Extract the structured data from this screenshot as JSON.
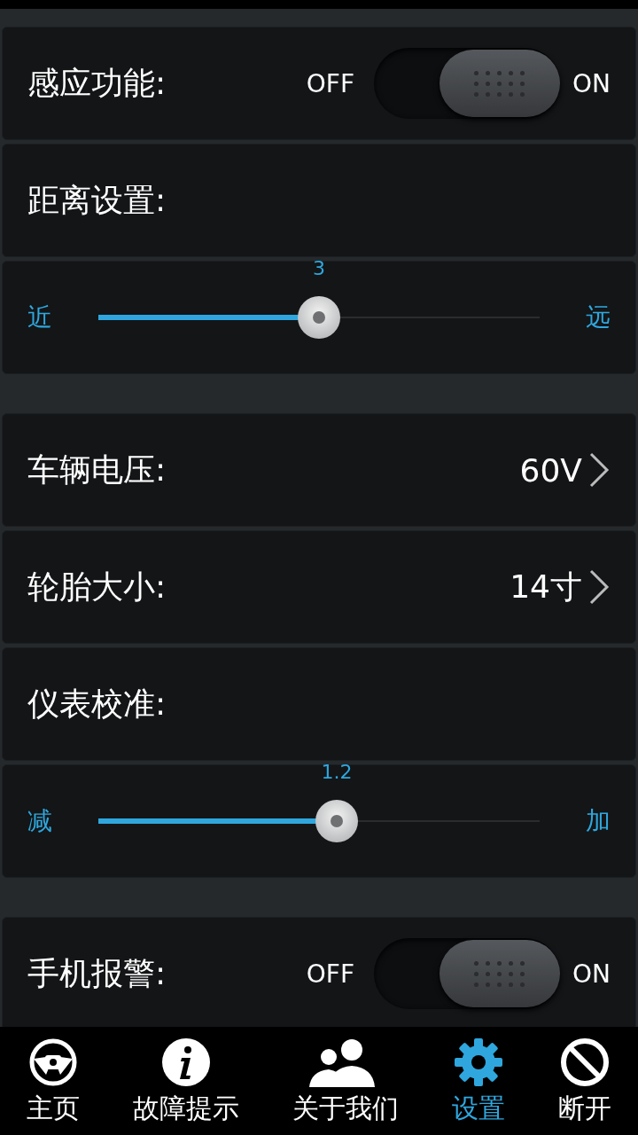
{
  "groups": [
    {
      "rows": [
        {
          "kind": "toggle",
          "label": "感应功能:",
          "off_text": "OFF",
          "on_text": "ON",
          "on": true
        },
        {
          "kind": "label",
          "label": "距离设置:"
        },
        {
          "kind": "slider",
          "min_label": "近",
          "max_label": "远",
          "reading": "3",
          "level": 0.5
        }
      ]
    },
    {
      "rows": [
        {
          "kind": "value",
          "label": "车辆电压:",
          "value": "60V"
        },
        {
          "kind": "value",
          "label": "轮胎大小:",
          "value": "14寸"
        },
        {
          "kind": "label",
          "label": "仪表校准:"
        },
        {
          "kind": "slider",
          "min_label": "减",
          "max_label": "加",
          "reading": "1.2",
          "level": 0.54
        }
      ]
    },
    {
      "rows": [
        {
          "kind": "toggle",
          "label": "手机报警:",
          "off_text": "OFF",
          "on_text": "ON",
          "on": true
        }
      ]
    }
  ],
  "nav": [
    {
      "label": "主页",
      "selected": false
    },
    {
      "label": "故障提示",
      "selected": false
    },
    {
      "label": "关于我们",
      "selected": false
    },
    {
      "label": "设置",
      "selected": true
    },
    {
      "label": "断开",
      "selected": false
    }
  ]
}
